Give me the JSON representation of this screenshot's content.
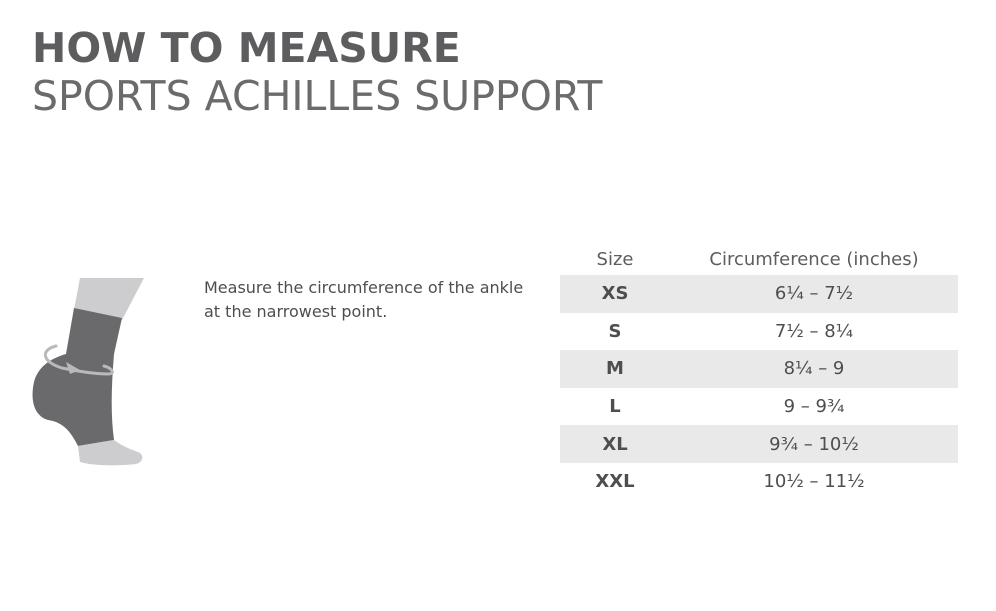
{
  "header": {
    "title": "HOW TO MEASURE",
    "subtitle": "SPORTS ACHILLES SUPPORT"
  },
  "illustration": {
    "icon": "ankle-with-measure-arrow-icon",
    "colors": {
      "leg": "#cdcdcf",
      "sleeve": "#6a6a6c",
      "arrow": "#b9b9bb"
    }
  },
  "instruction": {
    "text": "Measure the circumference of the ankle at the narrowest point."
  },
  "size_table": {
    "headers": {
      "size": "Size",
      "circumference": "Circumference (inches)"
    },
    "rows": [
      {
        "size": "XS",
        "range": "6¼ – 7½"
      },
      {
        "size": "S",
        "range": "7½ – 8¼"
      },
      {
        "size": "M",
        "range": "8¼ – 9"
      },
      {
        "size": "L",
        "range": "9 – 9¾"
      },
      {
        "size": "XL",
        "range": "9¾ – 10½"
      },
      {
        "size": "XXL",
        "range": "10½ – 11½"
      }
    ],
    "shade_color": "#e9e9ea"
  }
}
